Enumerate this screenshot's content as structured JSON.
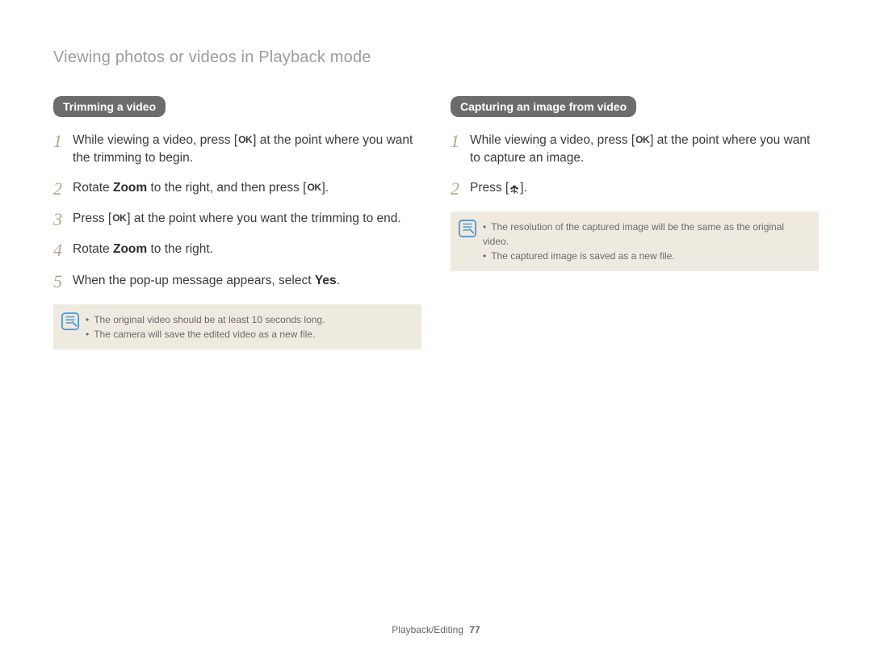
{
  "section_title": "Viewing photos or videos in Playback mode",
  "left": {
    "heading": "Trimming a video",
    "steps": [
      {
        "num": "1",
        "pre": "While viewing a video, press [",
        "icon": "ok",
        "post": "] at the point where you want the trimming to begin."
      },
      {
        "num": "2",
        "pre": "Rotate ",
        "bold1": "Zoom",
        "mid": " to the right, and then press [",
        "icon": "ok",
        "post": "]."
      },
      {
        "num": "3",
        "pre": "Press [",
        "icon": "ok",
        "post": "] at the point where you want the trimming to end."
      },
      {
        "num": "4",
        "pre": "Rotate ",
        "bold1": "Zoom",
        "mid": " to the right.",
        "icon": "",
        "post": ""
      },
      {
        "num": "5",
        "pre": "When the pop-up message appears, select ",
        "bold1": "Yes",
        "mid": ".",
        "icon": "",
        "post": ""
      }
    ],
    "notes": [
      "The original video should be at least 10 seconds long.",
      "The camera will save the edited video as a new file."
    ]
  },
  "right": {
    "heading": "Capturing an image from video",
    "steps": [
      {
        "num": "1",
        "pre": "While viewing a video, press [",
        "icon": "ok",
        "post": "] at the point where you want to capture an image."
      },
      {
        "num": "2",
        "pre": "Press [",
        "icon": "macro",
        "post": "]."
      }
    ],
    "notes": [
      "The resolution of the captured image will be the same as the original video.",
      "The captured image is saved as a new file."
    ]
  },
  "footer": {
    "section": "Playback/Editing",
    "page": "77"
  },
  "icons": {
    "ok_text": "OK"
  }
}
